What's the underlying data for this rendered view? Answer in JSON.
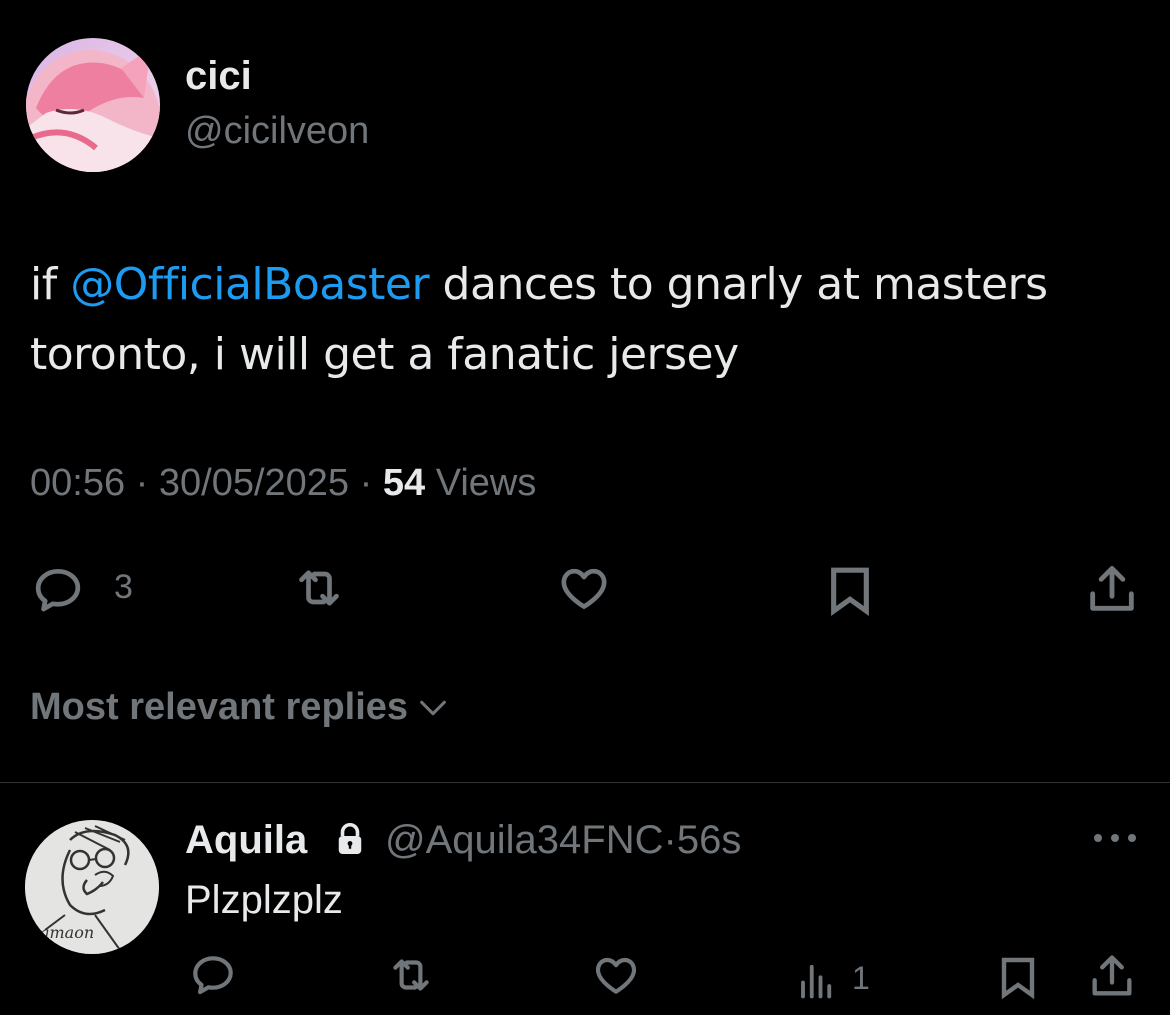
{
  "tweet": {
    "author": {
      "name": "cici",
      "handle": "@cicilveon"
    },
    "text_prefix": "if ",
    "mention": "@OfficialBoaster",
    "text_suffix": " dances to gnarly at masters toronto, i will get a fanatic jersey",
    "time": "00:56",
    "date": "30/05/2025",
    "separator": " · ",
    "views_count": "54",
    "views_label": "Views",
    "actions": {
      "reply_count": "3"
    }
  },
  "replies_sort": {
    "label": "Most relevant replies"
  },
  "reply": {
    "name": "Aquila",
    "handle": "@Aquila34FNC",
    "time": "56s",
    "separator": "·",
    "text": "Plzplzplz",
    "views_count": "1",
    "avatar_caption": "camaon"
  },
  "colors": {
    "background": "#000000",
    "primary_text": "#e7e9ea",
    "secondary_text": "#71767b",
    "mention": "#1d9bf0",
    "divider": "#2f3336"
  }
}
